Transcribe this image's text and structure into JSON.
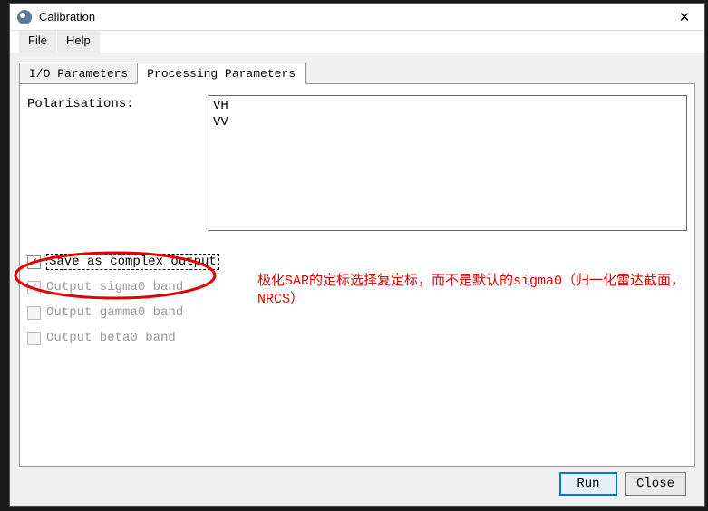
{
  "window": {
    "title": "Calibration"
  },
  "menubar": {
    "items": [
      "File",
      "Help"
    ]
  },
  "tabs": {
    "io": "I/O Parameters",
    "processing": "Processing Parameters",
    "active": "processing"
  },
  "panel": {
    "polarisations_label": "Polarisations:",
    "polarisations": [
      "VH",
      "VV"
    ],
    "checkboxes": {
      "save_complex": {
        "label": "Save as complex output",
        "checked": true,
        "enabled": true,
        "focused": true
      },
      "sigma0": {
        "label": "Output sigma0 band",
        "checked": true,
        "enabled": false
      },
      "gamma0": {
        "label": "Output gamma0 band",
        "checked": false,
        "enabled": false
      },
      "beta0": {
        "label": "Output beta0 band",
        "checked": false,
        "enabled": false
      }
    }
  },
  "buttons": {
    "run": "Run",
    "close": "Close"
  },
  "annotation": {
    "text": "极化SAR的定标选择复定标，而不是默认的sigma0（归一化雷达截面，NRCS）",
    "color": "#e00000"
  }
}
